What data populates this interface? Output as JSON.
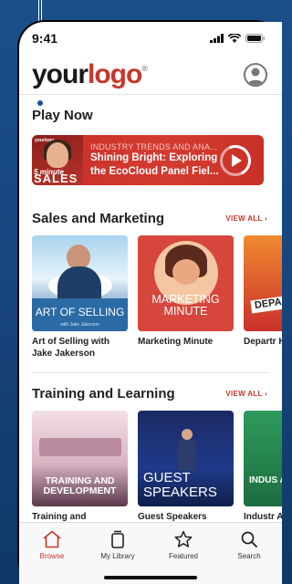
{
  "status": {
    "time": "9:41"
  },
  "header": {
    "logo_your": "your",
    "logo_logo": "logo",
    "logo_reg": "®"
  },
  "play_now": {
    "title": "Play Now",
    "thumb_brand": "yourlogo",
    "thumb_line1": "5 minute",
    "thumb_line2": "SALES",
    "kicker": "INDUSTRY TRENDS AND ANA...",
    "headline_1": "Shining Bright: Exploring",
    "headline_2": "the EcoCloud Panel Fiel..."
  },
  "sales": {
    "title": "Sales and Marketing",
    "view_all": "VIEW ALL ›",
    "cards": [
      {
        "thumb_title": "ART OF SELLING",
        "thumb_sub": "with Jake Jakerson",
        "label": "Art of Selling with Jake Jakerson"
      },
      {
        "thumb_title": "MARKETING MINUTE",
        "label": "Marketing Minute"
      },
      {
        "thumb_title": "DEPA HI",
        "label": "Departr Highlig"
      }
    ]
  },
  "training": {
    "title": "Training and Learning",
    "view_all": "VIEW ALL ›",
    "cards": [
      {
        "thumb_title": "TRAINING AND DEVELOPMENT",
        "label": "Training and Development"
      },
      {
        "thumb_title": "GUEST SPEAKERS",
        "label": "Guest Speakers"
      },
      {
        "thumb_title": "INDUS AND",
        "label": "Industr Analysi"
      }
    ]
  },
  "tabs": [
    {
      "label": "Browse",
      "icon": "home-icon",
      "active": true
    },
    {
      "label": "My Library",
      "icon": "library-icon",
      "active": false
    },
    {
      "label": "Featured",
      "icon": "star-icon",
      "active": false
    },
    {
      "label": "Search",
      "icon": "search-icon",
      "active": false
    }
  ],
  "colors": {
    "accent": "#c8372c",
    "background": "#1b4f8a"
  }
}
